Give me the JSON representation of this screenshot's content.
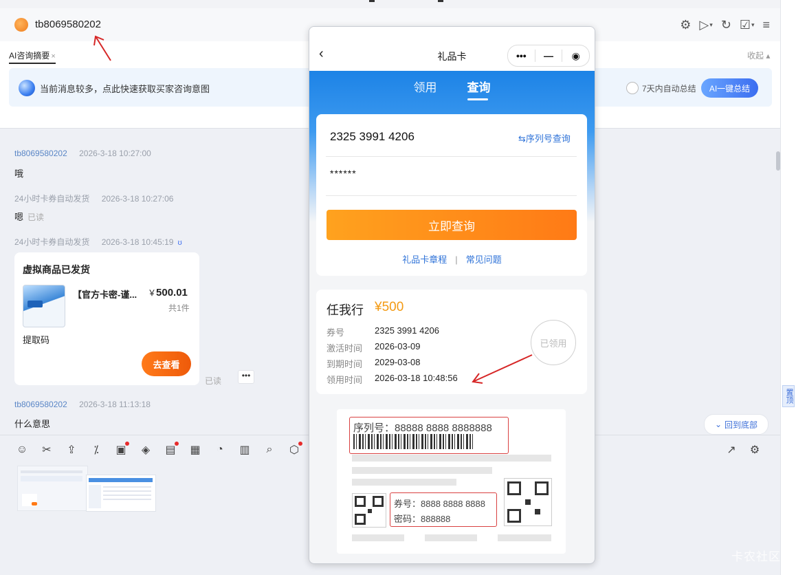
{
  "header": {
    "username": "tb8069580202"
  },
  "ai_panel": {
    "tab_label": "AI咨询摘要",
    "tab_close": "×",
    "collapse_label": "收起 ▴",
    "banner_text": "当前消息较多，点此快速获取买家咨询意图",
    "auto_summary_label": "7天内自动总结",
    "summary_button": "AI一键总结"
  },
  "messages": [
    {
      "sender": "tb8069580202",
      "time": "2026-3-18 10:27:00",
      "text": "哦"
    },
    {
      "sender": "24小时卡券自动发货",
      "time": "2026-3-18 10:27:06",
      "text": "嗯",
      "status": "已读"
    },
    {
      "sender": "24小时卡券自动发货",
      "time": "2026-3-18 10:45:19",
      "shield": "ʊ"
    },
    {
      "sender": "tb8069580202",
      "time": "2026-3-18 11:13:18",
      "text": "什么意思"
    }
  ],
  "order_card": {
    "title": "虚拟商品已发货",
    "product_name": "【官方卡密-谨...",
    "price_symbol": "￥",
    "price": "500.01",
    "count": "共1件",
    "code_label": "提取码",
    "view_button": "去查看",
    "status": "已读",
    "more": "•••"
  },
  "chat_footer": {
    "back_to_bottom": "回到底部",
    "toolbar_icons": [
      "emoji-icon",
      "scissors-icon",
      "upload-icon",
      "fraction-icon",
      "coupon-icon",
      "tag-icon",
      "bill-icon",
      "calendar-add-icon",
      "refresh-face-icon",
      "clipboard-icon",
      "search-zoom-icon",
      "shield-settings-icon"
    ],
    "toolbar_right_icons": [
      "share-icon",
      "chat-settings-icon"
    ]
  },
  "phone": {
    "back": "‹",
    "title": "礼品卡",
    "capsule_more": "•••",
    "capsule_min": "—",
    "capsule_close": "◉",
    "tabs": [
      {
        "label": "领用",
        "active": false
      },
      {
        "label": "查询",
        "active": true
      }
    ],
    "query": {
      "serial_value": "2325 3991 4206",
      "serial_link": "⇆序列号查询",
      "password_value": "******",
      "query_button": "立即查询",
      "rules_link": "礼品卡章程",
      "separator": "|",
      "faq_link": "常见问题"
    },
    "result": {
      "name": "任我行",
      "amount": "¥500",
      "rows": [
        {
          "label": "券号",
          "value": "2325 3991 4206"
        },
        {
          "label": "激活时间",
          "value": "2026-03-09"
        },
        {
          "label": "到期时间",
          "value": "2029-03-08"
        },
        {
          "label": "领用时间",
          "value": "2026-03-18 10:48:56"
        }
      ],
      "stamp": "已领用"
    },
    "sample": {
      "serial": "序列号：88888 8888 8888888",
      "card_no": "券号：8888 8888 8888",
      "password": "密码：888888"
    }
  },
  "side": {
    "pin_label": "置顶"
  },
  "watermark": "卡农社区",
  "colors": {
    "accent_blue": "#3b6df0",
    "orange": "#ff7a16",
    "annotation_red": "#d62626",
    "gold": "#f39a13"
  }
}
